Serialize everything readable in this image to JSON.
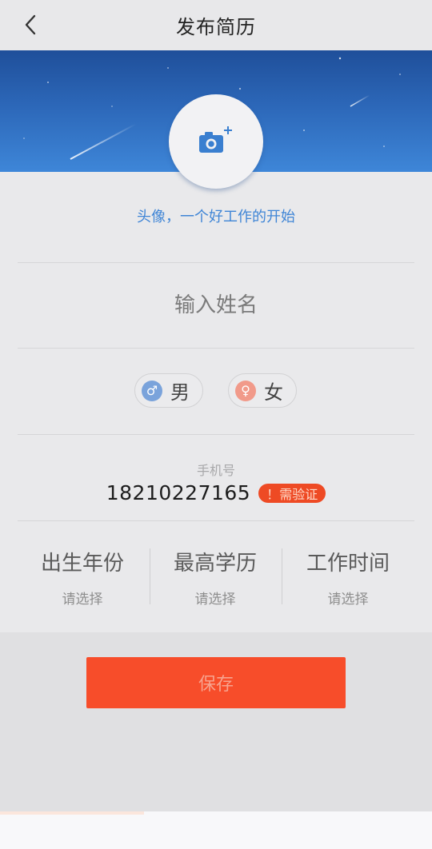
{
  "header": {
    "title": "发布简历",
    "back_icon": "chevron-left-icon"
  },
  "avatar": {
    "icon": "camera-plus-icon",
    "hint": "头像，一个好工作的开始"
  },
  "name": {
    "placeholder": "输入姓名",
    "value": ""
  },
  "gender": {
    "male": {
      "label": "男",
      "symbol": "♂",
      "icon": "male-icon",
      "color": "#7aa3db"
    },
    "female": {
      "label": "女",
      "symbol": "♀",
      "icon": "female-icon",
      "color": "#f19a8a"
    }
  },
  "phone": {
    "label": "手机号",
    "number": "18210227165",
    "verify_label": "！需验证"
  },
  "pickers": [
    {
      "title": "出生年份",
      "value": "请选择"
    },
    {
      "title": "最高学历",
      "value": "请选择"
    },
    {
      "title": "工作时间",
      "value": "请选择"
    }
  ],
  "save_label": "保存",
  "colors": {
    "accent": "#3f85d6",
    "primary_button": "#f74d2a",
    "badge": "#ee4a24"
  }
}
